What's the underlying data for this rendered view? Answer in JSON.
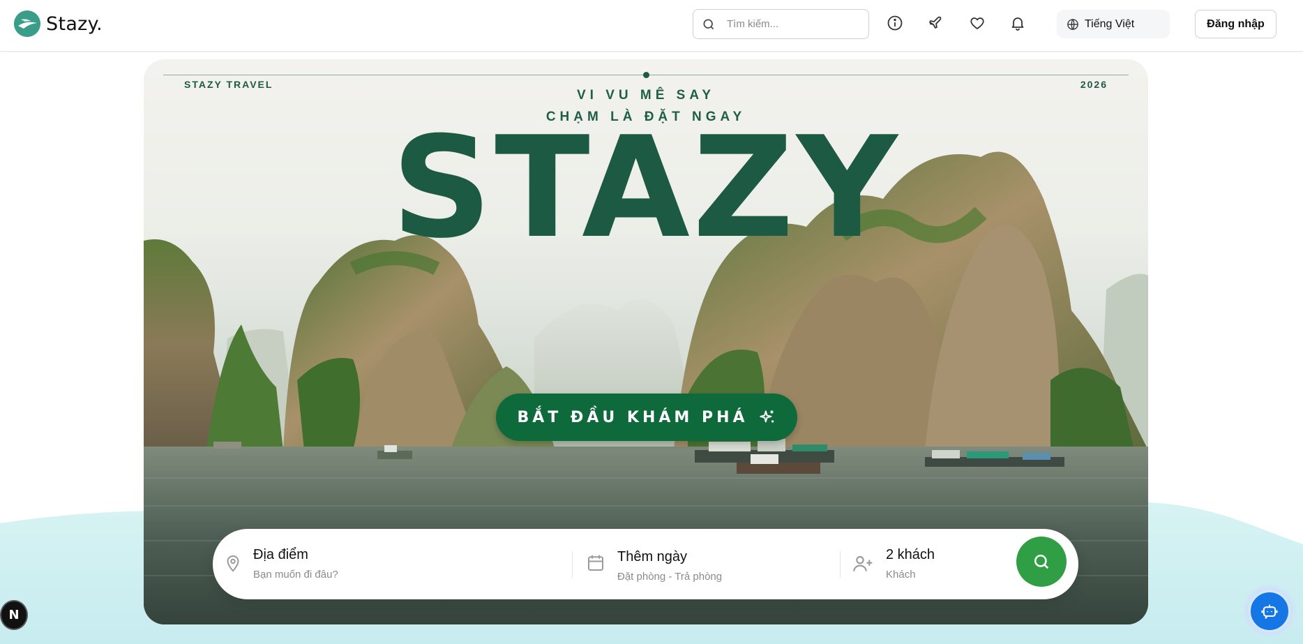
{
  "header": {
    "logo_text": "Stazy.",
    "search_placeholder": "Tìm kiếm...",
    "language_label": "Tiếng Việt",
    "login_label": "Đăng nhập",
    "icons": [
      "search-icon",
      "info-icon",
      "plane-icon",
      "heart-icon",
      "bell-icon",
      "globe-icon"
    ]
  },
  "hero": {
    "brand_left": "STAZY TRAVEL",
    "brand_right": "2026",
    "tagline_1": "VI VU MÊ SAY",
    "tagline_2": "CHẠM LÀ ĐẶT NGAY",
    "headline": "STAZY",
    "cta_label": "BẮT ĐẦU KHÁM PHÁ",
    "cta_icon": "sparkles-icon"
  },
  "booking": {
    "location": {
      "title": "Địa điểm",
      "subtitle": "Bạn muốn đi đâu?"
    },
    "dates": {
      "title": "Thêm ngày",
      "subtitle": "Đặt phòng - Trả phòng"
    },
    "guests": {
      "title": "2 khách",
      "subtitle": "Khách"
    },
    "search_icon": "search-icon"
  },
  "floating": {
    "dev_badge": "N",
    "chatbot_icon": "bot-icon"
  },
  "colors": {
    "brand_green": "#1c5a44",
    "cta_green": "#0f6a3b",
    "search_button": "#2f9e45",
    "chatbot_blue": "#1576e5",
    "logo_teal": "#3a9d8a"
  }
}
